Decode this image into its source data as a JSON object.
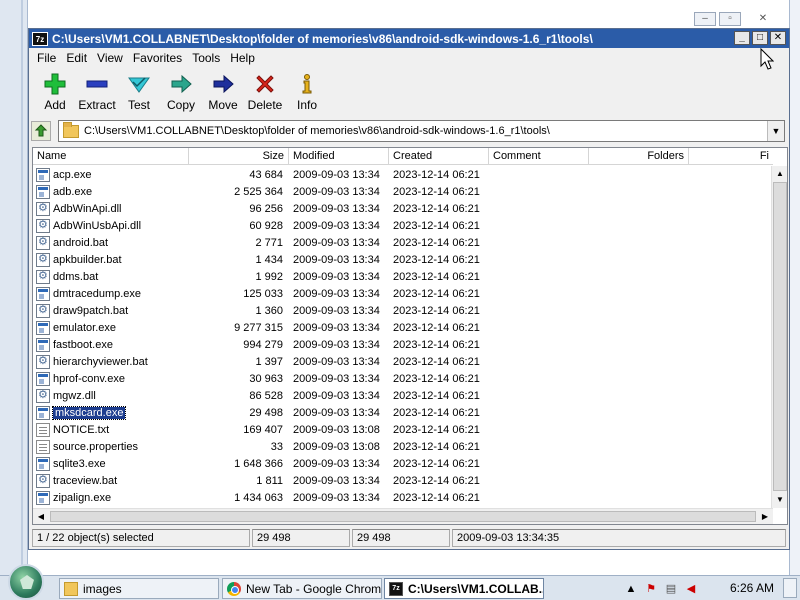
{
  "window": {
    "app_icon_text": "7z",
    "title": "C:\\Users\\VM1.COLLABNET\\Desktop\\folder of memories\\v86\\android-sdk-windows-1.6_r1\\tools\\"
  },
  "menu": [
    "File",
    "Edit",
    "View",
    "Favorites",
    "Tools",
    "Help"
  ],
  "toolbar": {
    "add": "Add",
    "extract": "Extract",
    "test": "Test",
    "copy": "Copy",
    "move": "Move",
    "delete": "Delete",
    "info": "Info"
  },
  "address": {
    "path": "C:\\Users\\VM1.COLLABNET\\Desktop\\folder of memories\\v86\\android-sdk-windows-1.6_r1\\tools\\"
  },
  "columns": {
    "name": "Name",
    "size": "Size",
    "modified": "Modified",
    "created": "Created",
    "comment": "Comment",
    "folders": "Folders",
    "files": "Fi"
  },
  "files": [
    {
      "name": "acp.exe",
      "size": "43 684",
      "modified": "2009-09-03 13:34",
      "created": "2023-12-14 06:21",
      "icon": "exe"
    },
    {
      "name": "adb.exe",
      "size": "2 525 364",
      "modified": "2009-09-03 13:34",
      "created": "2023-12-14 06:21",
      "icon": "exe"
    },
    {
      "name": "AdbWinApi.dll",
      "size": "96 256",
      "modified": "2009-09-03 13:34",
      "created": "2023-12-14 06:21",
      "icon": "gear"
    },
    {
      "name": "AdbWinUsbApi.dll",
      "size": "60 928",
      "modified": "2009-09-03 13:34",
      "created": "2023-12-14 06:21",
      "icon": "gear"
    },
    {
      "name": "android.bat",
      "size": "2 771",
      "modified": "2009-09-03 13:34",
      "created": "2023-12-14 06:21",
      "icon": "gear"
    },
    {
      "name": "apkbuilder.bat",
      "size": "1 434",
      "modified": "2009-09-03 13:34",
      "created": "2023-12-14 06:21",
      "icon": "gear"
    },
    {
      "name": "ddms.bat",
      "size": "1 992",
      "modified": "2009-09-03 13:34",
      "created": "2023-12-14 06:21",
      "icon": "gear"
    },
    {
      "name": "dmtracedump.exe",
      "size": "125 033",
      "modified": "2009-09-03 13:34",
      "created": "2023-12-14 06:21",
      "icon": "exe"
    },
    {
      "name": "draw9patch.bat",
      "size": "1 360",
      "modified": "2009-09-03 13:34",
      "created": "2023-12-14 06:21",
      "icon": "gear"
    },
    {
      "name": "emulator.exe",
      "size": "9 277 315",
      "modified": "2009-09-03 13:34",
      "created": "2023-12-14 06:21",
      "icon": "exe"
    },
    {
      "name": "fastboot.exe",
      "size": "994 279",
      "modified": "2009-09-03 13:34",
      "created": "2023-12-14 06:21",
      "icon": "exe"
    },
    {
      "name": "hierarchyviewer.bat",
      "size": "1 397",
      "modified": "2009-09-03 13:34",
      "created": "2023-12-14 06:21",
      "icon": "gear"
    },
    {
      "name": "hprof-conv.exe",
      "size": "30 963",
      "modified": "2009-09-03 13:34",
      "created": "2023-12-14 06:21",
      "icon": "exe"
    },
    {
      "name": "mgwz.dll",
      "size": "86 528",
      "modified": "2009-09-03 13:34",
      "created": "2023-12-14 06:21",
      "icon": "gear"
    },
    {
      "name": "mksdcard.exe",
      "size": "29 498",
      "modified": "2009-09-03 13:34",
      "created": "2023-12-14 06:21",
      "icon": "exe",
      "selected": true
    },
    {
      "name": "NOTICE.txt",
      "size": "169 407",
      "modified": "2009-09-03 13:08",
      "created": "2023-12-14 06:21",
      "icon": "txt"
    },
    {
      "name": "source.properties",
      "size": "33",
      "modified": "2009-09-03 13:08",
      "created": "2023-12-14 06:21",
      "icon": "txt"
    },
    {
      "name": "sqlite3.exe",
      "size": "1 648 366",
      "modified": "2009-09-03 13:34",
      "created": "2023-12-14 06:21",
      "icon": "exe"
    },
    {
      "name": "traceview.bat",
      "size": "1 811",
      "modified": "2009-09-03 13:34",
      "created": "2023-12-14 06:21",
      "icon": "gear"
    },
    {
      "name": "zipalign.exe",
      "size": "1 434 063",
      "modified": "2009-09-03 13:34",
      "created": "2023-12-14 06:21",
      "icon": "exe"
    }
  ],
  "status": {
    "selection": "1 / 22 object(s) selected",
    "size": "29 498",
    "packed": "29 498",
    "modified": "2009-09-03 13:34:35"
  },
  "taskbar": {
    "items": [
      "images",
      "New Tab - Google Chrome",
      "C:\\Users\\VM1.COLLAB..."
    ],
    "clock": "6:26 AM"
  },
  "colors": {
    "titlebar": "#2b5ca8",
    "selection": "#1d3d8f"
  }
}
